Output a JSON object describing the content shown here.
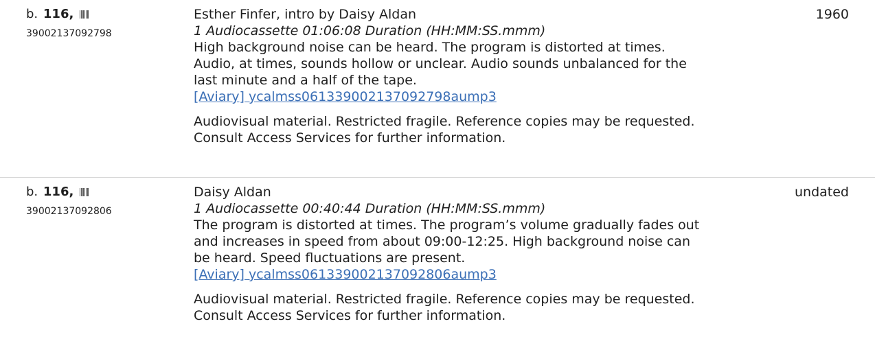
{
  "items": [
    {
      "box_prefix": "b.",
      "box_number": "116,",
      "barcode": "39002137092798",
      "title": "Esther Finfer, intro by Daisy Aldan",
      "extent": "1 Audiocassette  01:06:08 Duration (HH:MM:SS.mmm)",
      "note_lines": [
        "High background noise can be heard. The program is distorted at times.",
        "Audio, at times, sounds hollow or unclear. Audio sounds unbalanced for the",
        "last minute and a half of the tape."
      ],
      "link": "[Aviary] ycalmss061339002137092798aump3",
      "access_lines": [
        "Audiovisual material. Restricted fragile. Reference copies may be requested.",
        "Consult Access Services for further information."
      ],
      "date": "1960"
    },
    {
      "box_prefix": "b.",
      "box_number": "116,",
      "barcode": "39002137092806",
      "title": "Daisy Aldan",
      "extent": "1 Audiocassette  00:40:44 Duration (HH:MM:SS.mmm)",
      "note_lines": [
        "The program is distorted at times. The program’s volume gradually fades out",
        "and increases in speed from about 09:00-12:25. High background noise can",
        "be heard. Speed fluctuations are present."
      ],
      "link": "[Aviary] ycalmss061339002137092806aump3",
      "access_lines": [
        "Audiovisual material. Restricted fragile. Reference copies may be requested.",
        "Consult Access Services for further information."
      ],
      "date": "undated"
    }
  ]
}
